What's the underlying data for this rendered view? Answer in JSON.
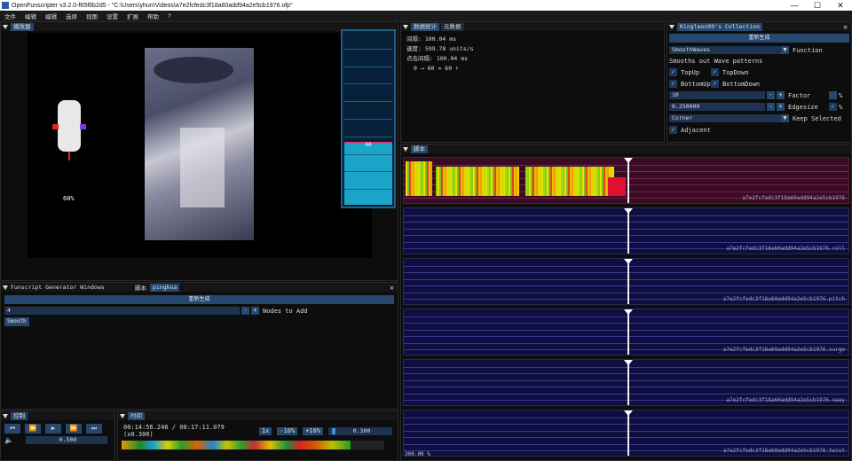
{
  "window": {
    "title": "OpenFunscripter v3.2.0-f65f6b2d5 - \"C:\\Users\\yhun\\Videos\\a7e2fcfedc3f18a60add94a2e5cb1976.ofp\"",
    "buttons": [
      "—",
      "☐",
      "✕"
    ]
  },
  "menu": [
    "文件",
    "编辑",
    "编辑",
    "选择",
    "视图",
    "设置",
    "扩展",
    "帮助",
    "?"
  ],
  "simulator": {
    "title": "播放器",
    "percent": "60%"
  },
  "overlay_bar": {
    "value": "60",
    "level": 0.6
  },
  "stats": {
    "tabs": [
      "数据统计",
      "元数据"
    ],
    "lines": [
      "间隔: 100.04 ms",
      "速度: 599.78 units/s",
      "点击间隔: 100.04 ms"
    ],
    "arrow_line": {
      "from": "0",
      "to": "60",
      "sep": "=",
      "result": "60"
    }
  },
  "collection": {
    "title": "Kingleon99's Collection",
    "button": "重新生成",
    "mode": "SmoothWaves",
    "mode_label": "Function",
    "desc": "Smooths out Wave patterns",
    "checks": [
      {
        "label": "TopUp",
        "checked": true
      },
      {
        "label": "TopDown",
        "checked": true
      },
      {
        "label": "BottomUp",
        "checked": true
      },
      {
        "label": "BottomDown",
        "checked": true
      }
    ],
    "factor": {
      "value": "10",
      "label": "Factor",
      "unit": "%"
    },
    "edgesize": {
      "value": "0.250000",
      "label": "Edgesize",
      "unit": "%"
    },
    "corner": {
      "value": "Corner",
      "label": "Keep Selected"
    },
    "adjacent": {
      "label": "Adjacent",
      "checked": true
    }
  },
  "tracks": {
    "title": "脚本",
    "items": [
      {
        "name": "a7e2fcfedc3f18a60add94a2e5cb1976",
        "type": "heat"
      },
      {
        "name": "a7e2fcfedc3f18a60add94a2e5cb1976.roll",
        "type": "empty"
      },
      {
        "name": "a7e2fcfedc3f18a60add94a2e5cb1976.pitch",
        "type": "empty"
      },
      {
        "name": "a7e2fcfedc3f18a60add94a2e5cb1976.surge",
        "type": "empty"
      },
      {
        "name": "a7e2fcfedc3f18a60add94a2e5cb1976.sway",
        "type": "empty"
      },
      {
        "name": "a7e2fcfedc3f18a60add94a2e5cb1976.twist",
        "type": "empty"
      }
    ],
    "range": "300.00 %",
    "cursor_pos": 0.5
  },
  "generator": {
    "title": "Funscript Generator Windows",
    "tab_label": "脚本",
    "tab_value": "pinghua",
    "button": "重新生成",
    "nodes_value": "4",
    "nodes_label": "Nodes to Add",
    "smooth": "Smooth"
  },
  "control": {
    "title": "控制",
    "volume": "0.500",
    "buttons": [
      "first-icon",
      "rewind-icon",
      "play-icon",
      "forward-icon",
      "last-icon"
    ]
  },
  "timeline": {
    "title": "时间",
    "time": "00:14:56.246 / 00:17:11.079 (x0.300)",
    "speed_btns": [
      "1x",
      "-10%",
      "+10%"
    ],
    "speed": "0.300",
    "progress": 0.87
  },
  "colors": {
    "accent": "#26486e",
    "track_bg": "#0e0e42",
    "heat_bg": "#3b0a24"
  }
}
